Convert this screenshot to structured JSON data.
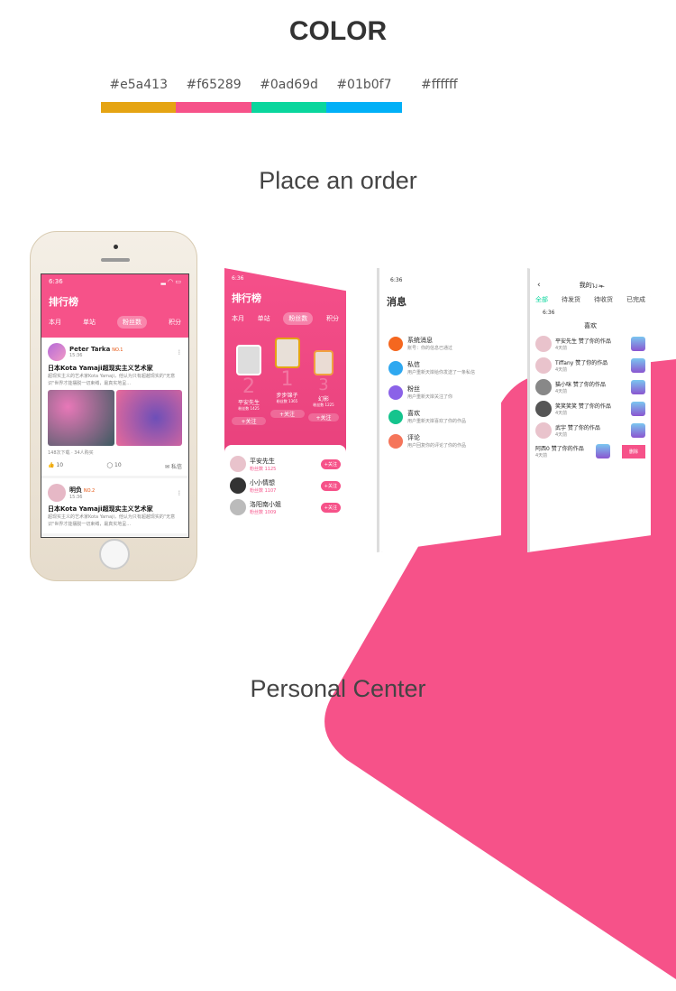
{
  "header": {
    "title": "COLOR"
  },
  "palette": [
    {
      "hex": "#e5a413"
    },
    {
      "hex": "#f65289"
    },
    {
      "hex": "#0ad69d"
    },
    {
      "hex": "#01b0f7"
    },
    {
      "hex": "#ffffff"
    }
  ],
  "sections": {
    "order": "Place an order",
    "personal": "Personal Center"
  },
  "accent": "#f65289",
  "phone": {
    "time": "6:36",
    "title": "排行榜",
    "tabs": [
      "本月",
      "单站",
      "粉丝数",
      "积分"
    ],
    "active_tab": 2,
    "posts": [
      {
        "name": "Peter Tarka",
        "rank": "NO.1",
        "time": "15:36",
        "title": "日本Kota Yamaji超现实主义艺术家",
        "desc": "超现实主义的艺术家Kota Yamaji，他认为只有超越现实的\"无意识\"世界才能摆脱一切束缚，最真实地呈...",
        "stats": "148次下载 · 34人购买",
        "likes": "10",
        "comments": "10",
        "message": "私信"
      },
      {
        "name": "明负",
        "rank": "NO.2",
        "time": "15:36",
        "title": "日本Kota Yamaji超现实主义艺术家",
        "desc": "超现实主义的艺术家Kota Yamaji，他认为只有超越现实的\"无意识\"世界才能摆脱一切束缚，最真实地呈..."
      }
    ]
  },
  "ranking": {
    "time": "6:36",
    "title": "排行榜",
    "tabs": [
      "本月",
      "单站",
      "粉丝数",
      "积分"
    ],
    "podium": [
      {
        "place": "2",
        "name": "平安先生",
        "score": "粉丝数 1425",
        "btn": "+关注"
      },
      {
        "place": "1",
        "name": "步步锦子",
        "score": "粉丝数 1365",
        "btn": "+关注"
      },
      {
        "place": "3",
        "name": "幻影",
        "score": "粉丝数 1225",
        "btn": "+关注"
      }
    ],
    "list": [
      {
        "name": "平安先生",
        "score": "粉丝数 1125",
        "btn": "+关注"
      },
      {
        "name": "小小情想",
        "score": "粉丝数 1107",
        "btn": "+关注"
      },
      {
        "name": "洛阳南小姐",
        "score": "粉丝数 1009",
        "btn": "+关注"
      }
    ]
  },
  "messages": {
    "time": "6:36",
    "title": "消息",
    "items": [
      {
        "title": "系统消息",
        "sub": "账号：你的信息已通过",
        "color": "#f5671f"
      },
      {
        "title": "私信",
        "sub": "用户重新天岸给你发送了一条私信",
        "color": "#2fa8f0"
      },
      {
        "title": "粉丝",
        "sub": "用户重新天岸关注了你",
        "color": "#8b62e8"
      },
      {
        "title": "喜欢",
        "sub": "用户重新天岸喜欢了你的作品",
        "color": "#15c48d"
      },
      {
        "title": "评论",
        "sub": "用户回复你的评论了你的作品",
        "color": "#f5755a"
      }
    ]
  },
  "orders": {
    "title": "我的订单",
    "tabs": [
      "全部",
      "待发货",
      "待收货",
      "已完成"
    ],
    "likes_title": "喜欢",
    "time": "6:36",
    "items": [
      {
        "text": "平安先生 赞了你的作品",
        "sub": "4天前"
      },
      {
        "text": "Tiffany 赞了你的作品",
        "sub": "4天前"
      },
      {
        "text": "猫小咪 赞了你的作品",
        "sub": "4天前"
      },
      {
        "text": "笑笑笑笑 赞了你的作品",
        "sub": "4天前"
      },
      {
        "text": "武宇 赞了你的作品",
        "sub": "4天前"
      },
      {
        "text": "阿西0 赞了你的作品",
        "sub": "4天前"
      }
    ],
    "delete": "删除"
  }
}
